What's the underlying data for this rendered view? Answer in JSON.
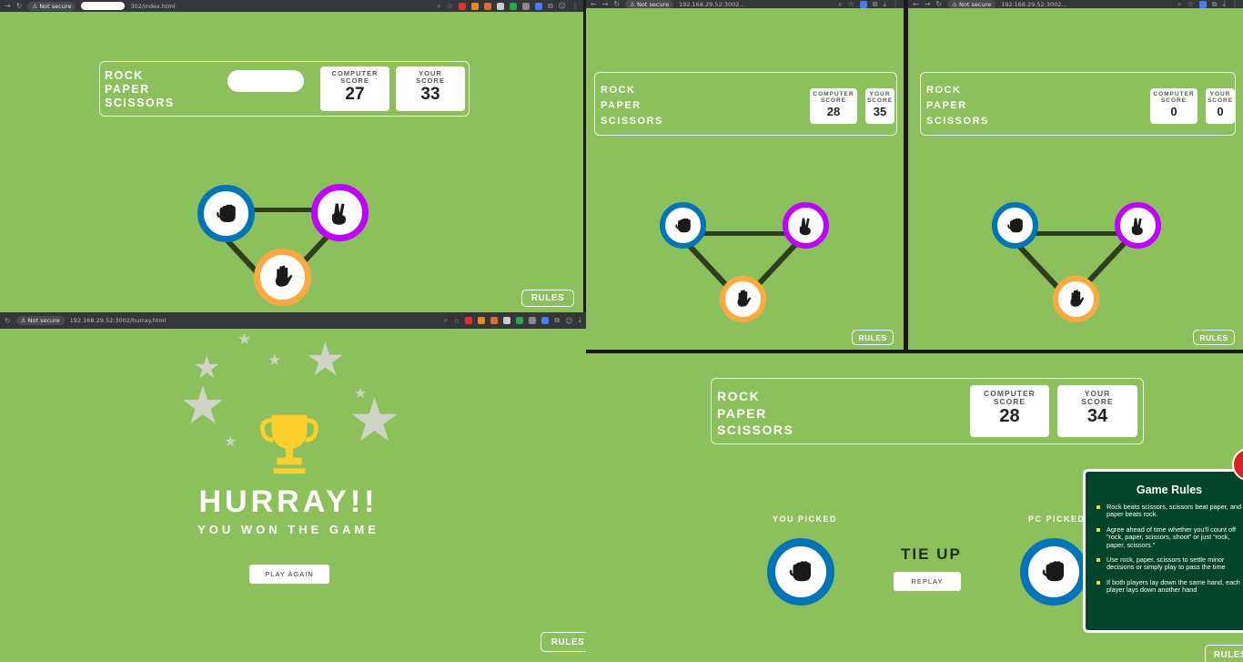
{
  "browser": {
    "not_secure": "Not secure",
    "url_index": "302/index.html",
    "url_host": "192.168.29.52:3002...",
    "url_hurray": "192.168.29.52:3002/hurray.html"
  },
  "game": {
    "title_lines": [
      "ROCK",
      "PAPER",
      "SCISSORS"
    ],
    "computer_label": [
      "COMPUTER",
      "SCORE"
    ],
    "your_label": [
      "YOUR",
      "SCORE"
    ],
    "rules_label": "RULES"
  },
  "screens": {
    "index_a": {
      "computer_score": "27",
      "your_score": "33"
    },
    "index_b": {
      "computer_score": "28",
      "your_score": "35"
    },
    "index_c": {
      "computer_score": "0",
      "your_score": "0"
    },
    "result": {
      "computer_score": "28",
      "your_score": "34"
    }
  },
  "hurray": {
    "title": "HURRAY!!",
    "subtitle": "YOU WON THE GAME",
    "play_again": "PLAY AGAIN"
  },
  "result_screen": {
    "you_picked": "YOU PICKED",
    "pc_picked": "PC PICKED",
    "result": "TIE UP",
    "replay": "REPLAY"
  },
  "rules_panel": {
    "title": "Game Rules",
    "items": [
      "Rock beats scissors, scissors beat paper, and paper beats rock.",
      "Agree ahead of time whether you'll count off “rock, paper, scissors, shoot” or just “rock, paper, scissors.”",
      "Use rock, paper, scissors to settle minor decisions or simply play to pass the time",
      "If both players lay down the same hand, each player lays down another hand"
    ]
  },
  "colors": {
    "background": "#8bc05d",
    "rock": "#0074b6",
    "scissors": "#bd00ff",
    "paper": "#ffa943",
    "link": "#2d3f1c",
    "trophy": "#ffcf2e",
    "rules_panel": "#004429"
  },
  "icons": [
    "fist-icon",
    "peace-sign-icon",
    "open-hand-icon",
    "trophy-icon",
    "star-icon"
  ]
}
